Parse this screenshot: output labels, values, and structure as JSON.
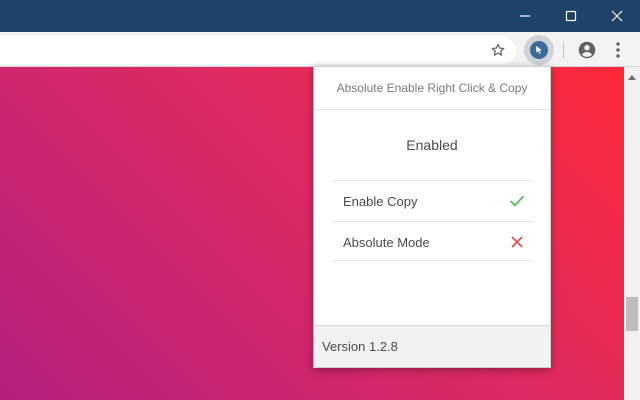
{
  "window_controls": {
    "minimize_icon": "minimize-icon",
    "maximize_icon": "maximize-icon",
    "close_icon": "close-icon"
  },
  "toolbar": {
    "bookmark_icon": "star-icon",
    "extension_icon": "cursor-icon",
    "profile_icon": "account-circle-icon",
    "menu_icon": "kebab-menu-icon"
  },
  "popup": {
    "title": "Absolute Enable Right Click & Copy",
    "status": "Enabled",
    "options": [
      {
        "label": "Enable Copy",
        "state": "on",
        "icon": "check-icon",
        "color": "#5cb85c"
      },
      {
        "label": "Absolute Mode",
        "state": "off",
        "icon": "cross-icon",
        "color": "#d9534f"
      }
    ],
    "version": "Version 1.2.8"
  },
  "colors": {
    "titlebar": "#1f426a",
    "toolbar": "#f1f3f4",
    "gradient_start": "#ff2a3a",
    "gradient_end": "#b51f7e",
    "check": "#5cb85c",
    "cross": "#d9534f"
  }
}
